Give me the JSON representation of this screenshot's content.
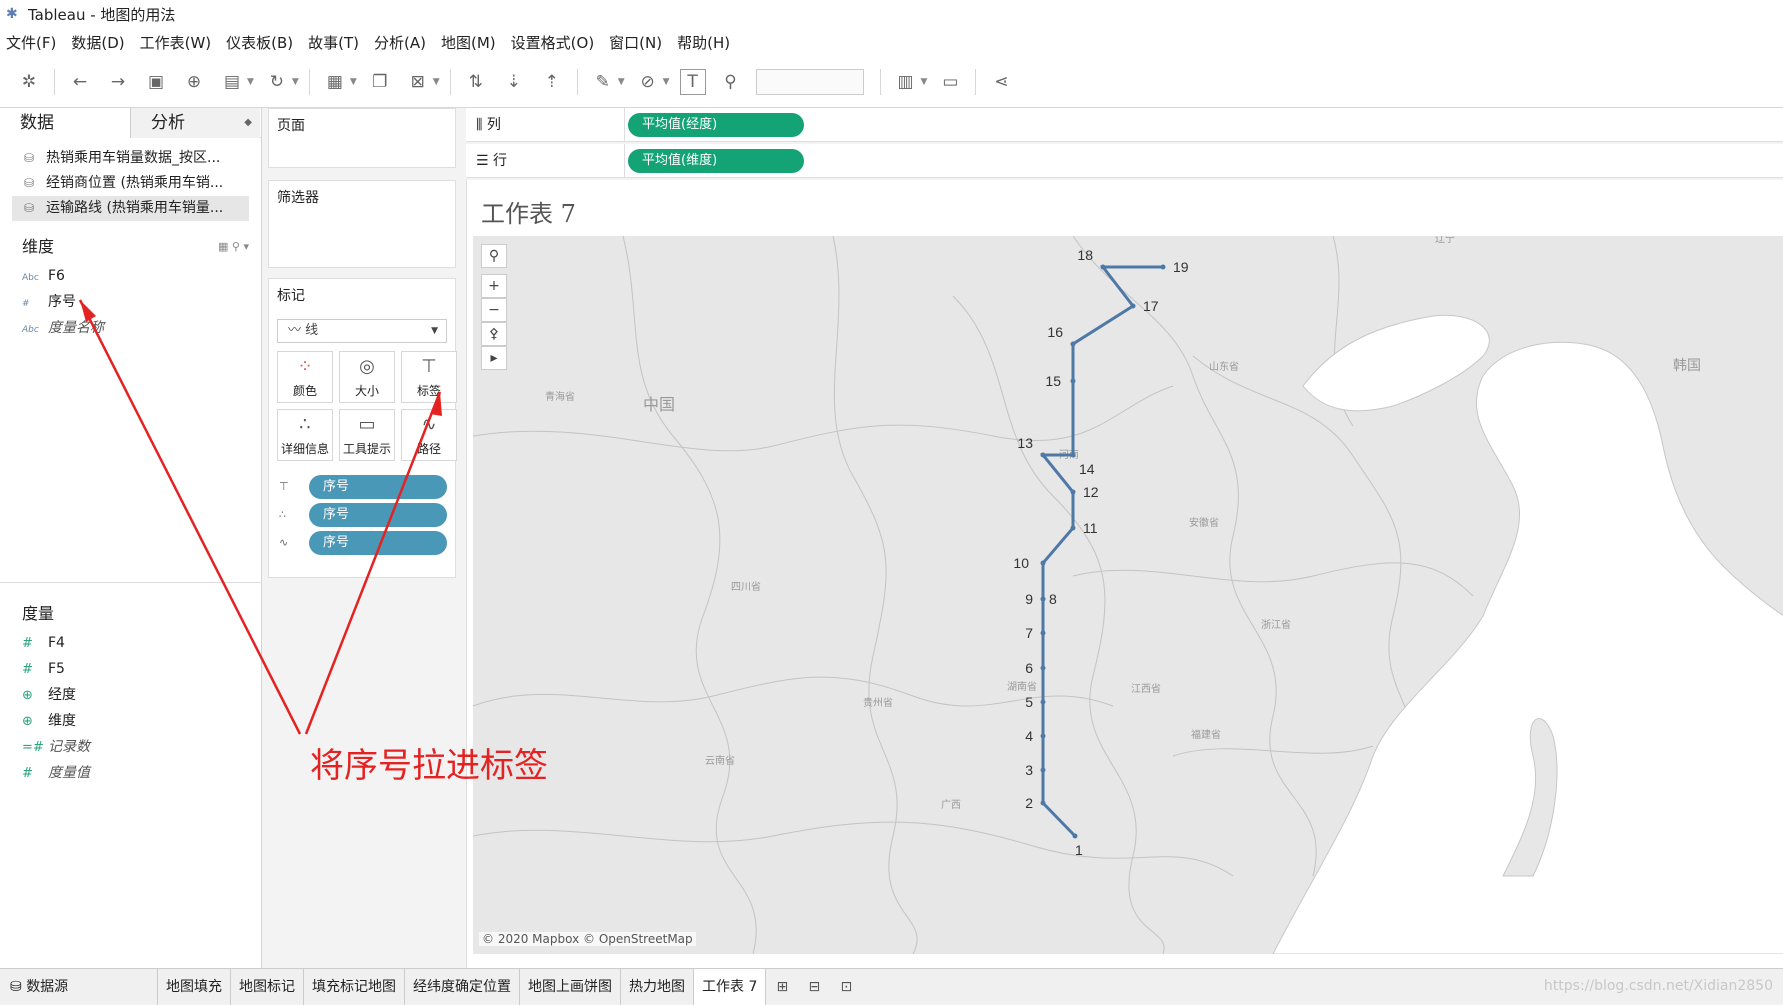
{
  "window": {
    "title": "Tableau - 地图的用法"
  },
  "menu": [
    "文件(F)",
    "数据(D)",
    "工作表(W)",
    "仪表板(B)",
    "故事(T)",
    "分析(A)",
    "地图(M)",
    "设置格式(O)",
    "窗口(N)",
    "帮助(H)"
  ],
  "left": {
    "tab_data": "数据",
    "tab_analysis": "分析",
    "sources": [
      "热销乘用车销量数据_按区...",
      "经销商位置 (热销乘用车销...",
      "运输路线 (热销乘用车销量..."
    ],
    "dimensions_label": "维度",
    "dimensions": [
      {
        "type": "Abc",
        "name": "F6"
      },
      {
        "type": "#",
        "name": "序号"
      },
      {
        "type": "Abc",
        "name": "度量名称"
      }
    ],
    "measures_label": "度量",
    "measures": [
      {
        "type": "#",
        "name": "F4"
      },
      {
        "type": "#",
        "name": "F5"
      },
      {
        "type": "globe",
        "name": "经度"
      },
      {
        "type": "globe",
        "name": "维度"
      },
      {
        "type": "=#",
        "name": "记录数"
      },
      {
        "type": "#",
        "name": "度量值"
      }
    ]
  },
  "cards": {
    "pages": "页面",
    "filters": "筛选器",
    "marks": "标记",
    "mark_type": "线",
    "buttons": [
      "颜色",
      "大小",
      "标签",
      "详细信息",
      "工具提示",
      "路径"
    ],
    "pills": [
      {
        "icon": "label",
        "text": "序号"
      },
      {
        "icon": "detail",
        "text": "序号"
      },
      {
        "icon": "path",
        "text": "序号"
      }
    ]
  },
  "shelves": {
    "columns_label": "列",
    "columns_pill": "平均值(经度)",
    "rows_label": "行",
    "rows_pill": "平均值(维度)"
  },
  "view": {
    "title": "工作表 7",
    "attribution": "© 2020 Mapbox © OpenStreetMap",
    "region_labels": [
      "中国",
      "青海省",
      "四川省",
      "贵州省",
      "云南省",
      "广西",
      "湖南省",
      "江西省",
      "福建省",
      "浙江省",
      "安徽省",
      "山东省",
      "韩国",
      "辽宁",
      "河南"
    ]
  },
  "route": {
    "labels": [
      "1",
      "2",
      "3",
      "4",
      "5",
      "6",
      "7",
      "8",
      "9",
      "10",
      "11",
      "12",
      "13",
      "14",
      "15",
      "16",
      "17",
      "18",
      "19"
    ],
    "color": "#4e79a7"
  },
  "annotation": {
    "text": "将序号拉进标签",
    "color": "#e52222"
  },
  "sheets": {
    "datasource": "数据源",
    "tabs": [
      "地图填充",
      "地图标记",
      "填充标记地图",
      "经纬度确定位置",
      "地图上画饼图",
      "热力地图",
      "工作表 7"
    ]
  },
  "watermark": "https://blog.csdn.net/Xidian2850"
}
